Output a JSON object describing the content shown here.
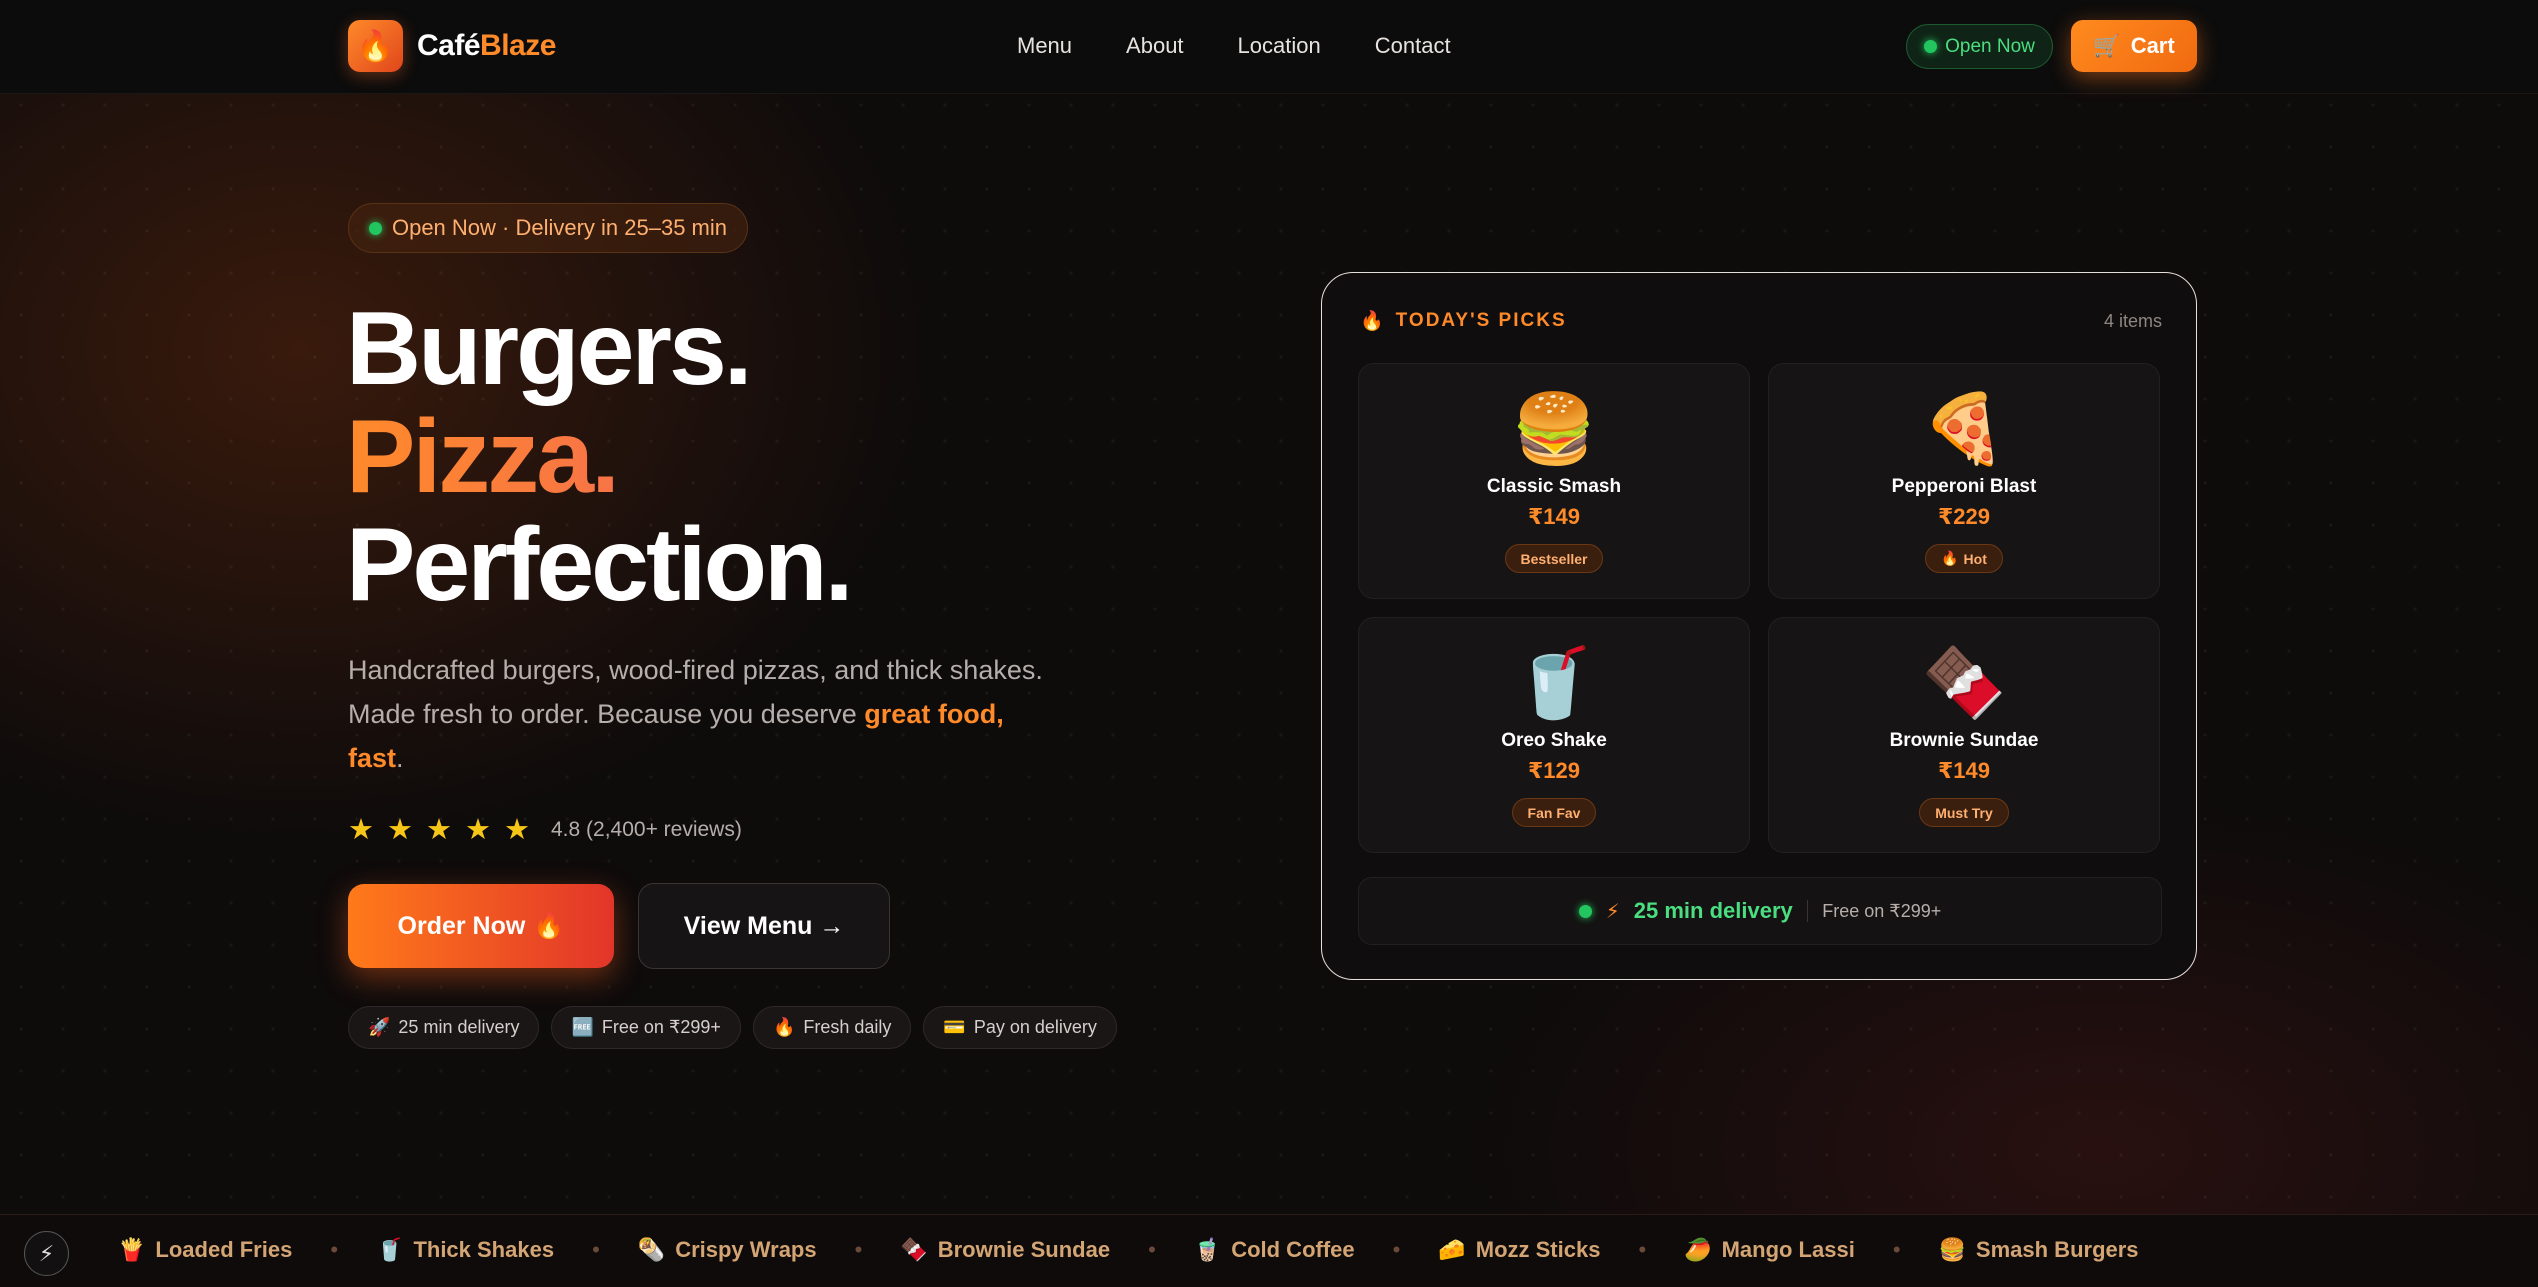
{
  "nav": {
    "logo_icon": "🔥",
    "brand_part1": "Café",
    "brand_part2": "Blaze",
    "links": [
      "Menu",
      "About",
      "Location",
      "Contact"
    ],
    "status": "Open Now",
    "cart_label": "Cart",
    "cart_icon": "🛒"
  },
  "hero": {
    "badge": "Open Now · Delivery in 25–35 min",
    "headline_line1": "Burgers.",
    "headline_line2": "Pizza.",
    "headline_line3": "Perfection.",
    "lead_text": "Handcrafted burgers, wood-fired pizzas, and thick shakes. Made fresh to order. Because you deserve ",
    "lead_highlight": "great food, fast",
    "lead_end": ".",
    "stars": 5,
    "rating_text": "4.8 (2,400+ reviews)",
    "order_label": "Order Now",
    "order_icon": "🔥",
    "menu_label": "View Menu →",
    "chips": [
      {
        "icon": "🚀",
        "label": "25 min delivery"
      },
      {
        "icon": "🆓",
        "label": "Free on ₹299+"
      },
      {
        "icon": "🔥",
        "label": "Fresh daily"
      },
      {
        "icon": "💳",
        "label": "Pay on delivery"
      }
    ]
  },
  "picks": {
    "title_icon": "🔥",
    "title": "TODAY'S PICKS",
    "count": "4 items",
    "items": [
      {
        "emoji": "🍔",
        "name": "Classic Smash",
        "price": "₹149",
        "tag_icon": "",
        "tag": "Bestseller"
      },
      {
        "emoji": "🍕",
        "name": "Pepperoni Blast",
        "price": "₹229",
        "tag_icon": "🔥",
        "tag": "Hot"
      },
      {
        "emoji": "🥤",
        "name": "Oreo Shake",
        "price": "₹129",
        "tag_icon": "",
        "tag": "Fan Fav"
      },
      {
        "emoji": "🍫",
        "name": "Brownie Sundae",
        "price": "₹149",
        "tag_icon": "",
        "tag": "Must Try"
      }
    ],
    "delivery_bolt": "⚡",
    "delivery_time": "25 min delivery",
    "delivery_free": "Free on ₹299+"
  },
  "marquee": {
    "bolt_icon": "⚡",
    "items": [
      {
        "icon": "🍟",
        "label": "Loaded Fries"
      },
      {
        "icon": "🥤",
        "label": "Thick Shakes"
      },
      {
        "icon": "🌯",
        "label": "Crispy Wraps"
      },
      {
        "icon": "🍫",
        "label": "Brownie Sundae"
      },
      {
        "icon": "🧋",
        "label": "Cold Coffee"
      },
      {
        "icon": "🧀",
        "label": "Mozz Sticks"
      },
      {
        "icon": "🥭",
        "label": "Mango Lassi"
      },
      {
        "icon": "🍔",
        "label": "Smash Burgers"
      }
    ],
    "separator": "•"
  },
  "colors": {
    "accent": "#ff8a2a",
    "accent_red": "#e2352a",
    "success": "#22c55e",
    "star": "#f5c518",
    "background": "#0e0b0b"
  }
}
